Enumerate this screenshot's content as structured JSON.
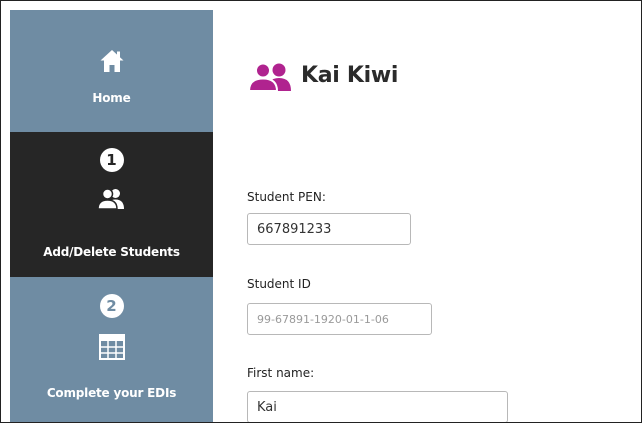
{
  "sidebar": {
    "items": [
      {
        "label": "Home",
        "icon": "home-icon"
      },
      {
        "step": "1",
        "label": "Add/Delete Students",
        "icon": "users-icon",
        "active": true
      },
      {
        "step": "2",
        "label": "Complete your EDIs",
        "icon": "table-icon"
      }
    ]
  },
  "main": {
    "title": "Kai Kiwi",
    "title_icon": "users-icon",
    "fields": [
      {
        "label": "Student PEN:",
        "value": "667891233"
      },
      {
        "label": "Student ID",
        "value": "99-67891-1920-01-1-06"
      },
      {
        "label": "First name:",
        "value": "Kai"
      }
    ]
  },
  "colors": {
    "sidebar_bg": "#6f8ca3",
    "sidebar_active_bg": "#262626",
    "title_icon": "#b0238f"
  }
}
